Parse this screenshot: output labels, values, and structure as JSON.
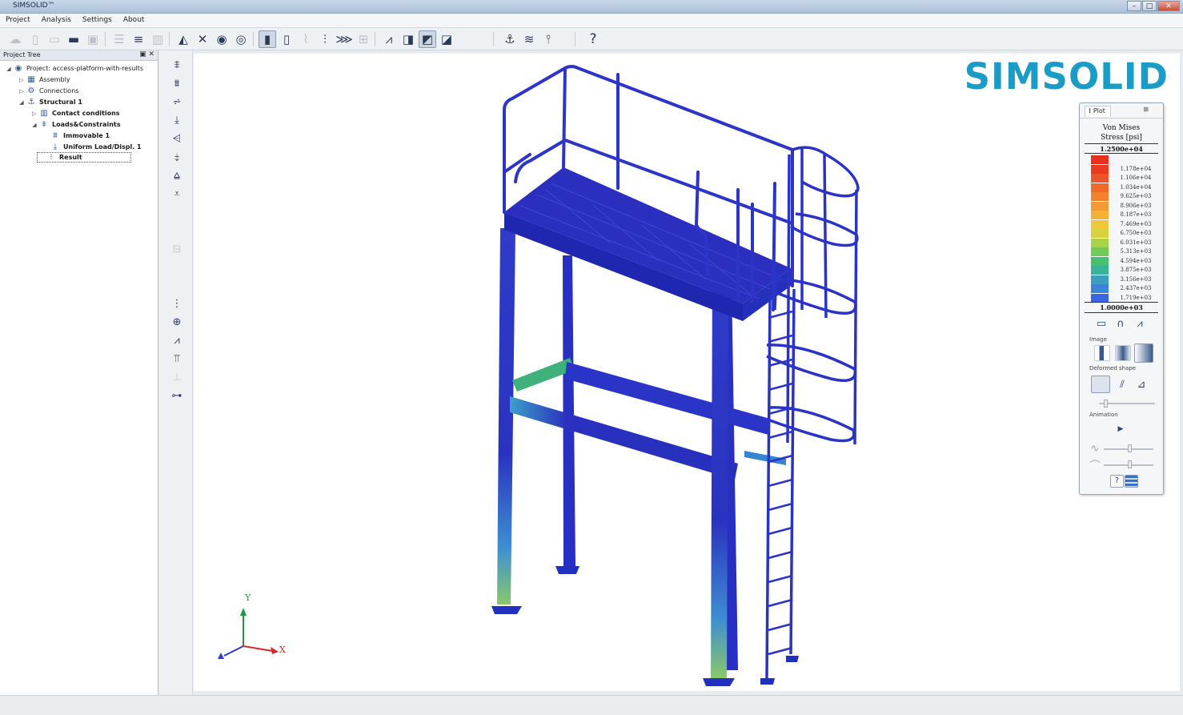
{
  "window": {
    "title": "SIMSOLID™"
  },
  "menu": [
    "Project",
    "Analysis",
    "Settings",
    "About"
  ],
  "toolbar": {
    "help_label": "?"
  },
  "project_tree": {
    "header": "Project Tree",
    "items": [
      {
        "label": "Project: access-platform-with-results",
        "level": 0,
        "expander": "◢",
        "icon": "project-icon"
      },
      {
        "label": "Assembly",
        "level": 1,
        "expander": "▷",
        "icon": "assembly-icon"
      },
      {
        "label": "Connections",
        "level": 1,
        "expander": "▷",
        "icon": "connections-icon"
      },
      {
        "label": "Structural 1",
        "level": 1,
        "expander": "◢",
        "icon": "structural-icon",
        "bold": true
      },
      {
        "label": "Contact conditions",
        "level": 2,
        "expander": "▷",
        "icon": "contact-icon",
        "bold": true
      },
      {
        "label": "Loads&Constraints",
        "level": 2,
        "expander": "◢",
        "icon": "loads-icon",
        "bold": true
      },
      {
        "label": "Immovable 1",
        "level": 3,
        "expander": "",
        "icon": "immovable-icon",
        "bold": true
      },
      {
        "label": "Uniform Load/Displ. 1",
        "level": 3,
        "expander": "",
        "icon": "uniform-load-icon",
        "bold": true
      },
      {
        "label": "Result",
        "level": 2,
        "expander": "",
        "icon": "result-icon",
        "bold": true,
        "selected": true
      }
    ]
  },
  "viewport": {
    "logo": "SIMSOLID",
    "axes": {
      "x": "X",
      "y": "Y"
    }
  },
  "plot_panel": {
    "tab_label": "Plot",
    "close": "⊠",
    "result_title_line1": "Von Mises",
    "result_title_line2": "Stress [psi]",
    "max_label": "1.2500e+04",
    "min_label": "1.0000e+03",
    "legend": [
      {
        "label": "",
        "color": "#e8321f"
      },
      {
        "label": "1.178e+04",
        "color": "#ea3b22"
      },
      {
        "label": "1.106e+04",
        "color": "#ec5326"
      },
      {
        "label": "1.034e+04",
        "color": "#ef6a2a"
      },
      {
        "label": "9.625e+03",
        "color": "#f1822e"
      },
      {
        "label": "8.906e+03",
        "color": "#f39a32"
      },
      {
        "label": "8.187e+03",
        "color": "#f4b136"
      },
      {
        "label": "7.469e+03",
        "color": "#f2c63a"
      },
      {
        "label": "6.750e+03",
        "color": "#d9d23f"
      },
      {
        "label": "6.031e+03",
        "color": "#a9d449"
      },
      {
        "label": "5.313e+03",
        "color": "#6fcb57"
      },
      {
        "label": "4.594e+03",
        "color": "#45c06f"
      },
      {
        "label": "3.875e+03",
        "color": "#3bb396"
      },
      {
        "label": "3.156e+03",
        "color": "#3a9fc0"
      },
      {
        "label": "2.437e+03",
        "color": "#3983d8"
      },
      {
        "label": "1.719e+03",
        "color": "#3765e4"
      }
    ],
    "image_section": "Image",
    "deformed_section": "Deformed shape",
    "animation_section": "Animation",
    "play": "▶",
    "help": "?"
  }
}
